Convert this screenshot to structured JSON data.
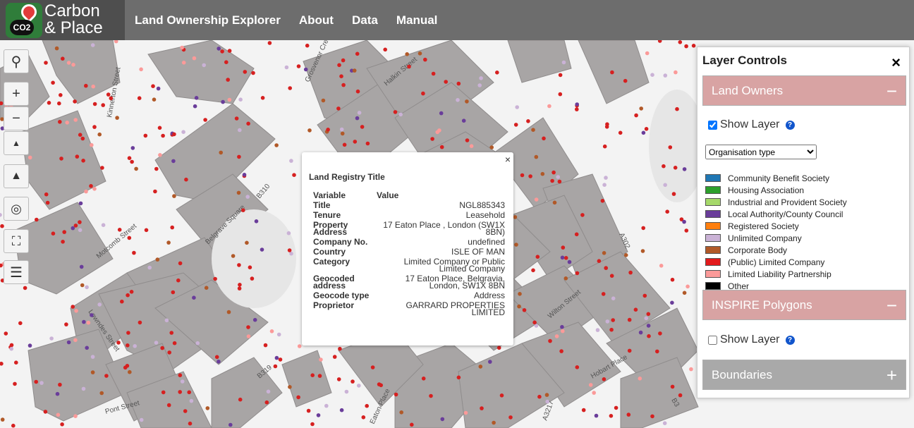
{
  "header": {
    "brand_line1": "Carbon",
    "brand_line2": "& Place",
    "logo_badge": "CO2",
    "nav": [
      "Land Ownership Explorer",
      "About",
      "Data",
      "Manual"
    ]
  },
  "map": {
    "road_labels": [
      "Kinnerton Street",
      "Grosvenor Cres",
      "Halkin Street",
      "B310",
      "Belgrave Square",
      "Motcomb Street",
      "Lowndes Street",
      "B319",
      "Wilton Street",
      "Hobart Place",
      "A302",
      "Eaton Place",
      "A3217",
      "Pont Street",
      "B3"
    ]
  },
  "popup": {
    "title": "Land Registry Title",
    "col_variable": "Variable",
    "col_value": "Value",
    "rows": [
      {
        "k": "Title",
        "v": "NGL885343"
      },
      {
        "k": "Tenure",
        "v": "Leasehold"
      },
      {
        "k": "Property Address",
        "v": "17 Eaton Place , London (SW1X 8BN)"
      },
      {
        "k": "Company No.",
        "v": "undefined"
      },
      {
        "k": "Country",
        "v": "ISLE OF MAN"
      },
      {
        "k": "Category",
        "v": "Limited Company or Public Limited Company"
      },
      {
        "k": "Geocoded address",
        "v": "17 Eaton Place, Belgravia, London, SW1X 8BN"
      },
      {
        "k": "Geocode type",
        "v": "Address"
      },
      {
        "k": "Proprietor",
        "v": "GARRARD PROPERTIES LIMITED"
      }
    ],
    "close": "×"
  },
  "panel": {
    "title": "Layer Controls",
    "close": "×",
    "land_owners": {
      "label": "Land Owners",
      "sign": "−",
      "show_label": "Show Layer",
      "checked": true
    },
    "select_value": "Organisation type",
    "legend": [
      {
        "label": "Community Benefit Society",
        "color": "#1f77b4"
      },
      {
        "label": "Housing Association",
        "color": "#2ca02c"
      },
      {
        "label": "Industrial and Provident Society",
        "color": "#a6d96a"
      },
      {
        "label": "Local Authority/County Council",
        "color": "#6a3d9a"
      },
      {
        "label": "Registered Society",
        "color": "#ff7f0e"
      },
      {
        "label": "Unlimited Company",
        "color": "#cab2d6"
      },
      {
        "label": "Corporate Body",
        "color": "#b15928"
      },
      {
        "label": "(Public) Limited Company",
        "color": "#e31a1c"
      },
      {
        "label": "Limited Liability Partnership",
        "color": "#fb9a99"
      },
      {
        "label": "Other",
        "color": "#000000"
      }
    ],
    "inspire": {
      "label": "INSPIRE Polygons",
      "sign": "−",
      "show_label": "Show Layer",
      "checked": false
    },
    "boundaries": {
      "label": "Boundaries",
      "sign": "+"
    }
  },
  "tools": [
    "search-icon",
    "zoom-in-icon",
    "zoom-out-icon",
    "compass-icon",
    "terrain-icon",
    "locate-icon",
    "fullscreen-icon",
    "layers-icon"
  ]
}
